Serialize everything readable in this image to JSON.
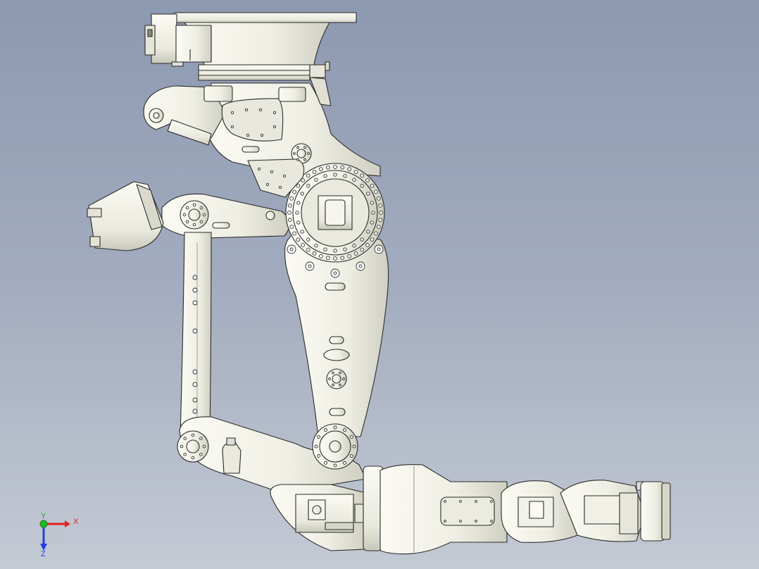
{
  "viewport": {
    "colors": {
      "background_top": "#8d99b1",
      "background_bottom": "#c4cad4",
      "part_fill": "#f1f1e8",
      "part_shade": "#d9d9cc",
      "edge": "#2b2b2b"
    }
  },
  "triad": {
    "x_label": "X",
    "y_label": "Y",
    "z_label": "Z",
    "colors": {
      "x": "#e02020",
      "y": "#22bb22",
      "z": "#2040e0"
    }
  }
}
